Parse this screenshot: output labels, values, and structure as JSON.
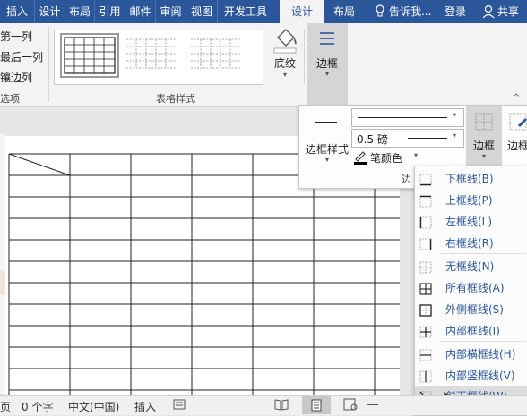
{
  "tabs": {
    "insert": "插入",
    "design1": "设计",
    "layout1": "布局",
    "references": "引用",
    "mailings": "邮件",
    "review": "审阅",
    "view": "视图",
    "developer": "开发工具",
    "table_design": "设计",
    "table_layout": "布局",
    "tell_me": "告诉我...",
    "login": "登录",
    "share": "共享"
  },
  "style_options": {
    "first_column": "第一列",
    "last_column": "最后一列",
    "banded_columns": "镶边列",
    "group_label": "选项"
  },
  "table_styles": {
    "group_label": "表格样式",
    "shading": "底纹",
    "borders": "边框"
  },
  "border_panel": {
    "border_styles": "边框样式",
    "pen_weight": "0.5 磅",
    "pen_color": "笔颜色",
    "borders": "边框",
    "border_painter": "边框",
    "group_label_partial": "边"
  },
  "border_menu": {
    "items": [
      {
        "label": "下框线(B)",
        "icon": "bottom-border-icon"
      },
      {
        "label": "上框线(P)",
        "icon": "top-border-icon"
      },
      {
        "label": "左框线(L)",
        "icon": "left-border-icon"
      },
      {
        "label": "右框线(R)",
        "icon": "right-border-icon"
      },
      {
        "label": "无框线(N)",
        "icon": "no-border-icon"
      },
      {
        "label": "所有框线(A)",
        "icon": "all-borders-icon"
      },
      {
        "label": "外侧框线(S)",
        "icon": "outside-borders-icon"
      },
      {
        "label": "内部框线(I)",
        "icon": "inside-borders-icon"
      },
      {
        "label": "内部横框线(H)",
        "icon": "inside-horizontal-border-icon"
      },
      {
        "label": "内部竖框线(V)",
        "icon": "inside-vertical-border-icon"
      },
      {
        "label": "斜下框线(W)",
        "icon": "diagonal-down-border-icon"
      }
    ]
  },
  "status": {
    "page_partial": "页",
    "word_count": "0 个字",
    "language": "中文(中国)",
    "insert_mode": "插入"
  },
  "colors": {
    "accent": "#2b579a",
    "ribbon": "#f3f3f3",
    "highlight": "#d5d5d5"
  }
}
